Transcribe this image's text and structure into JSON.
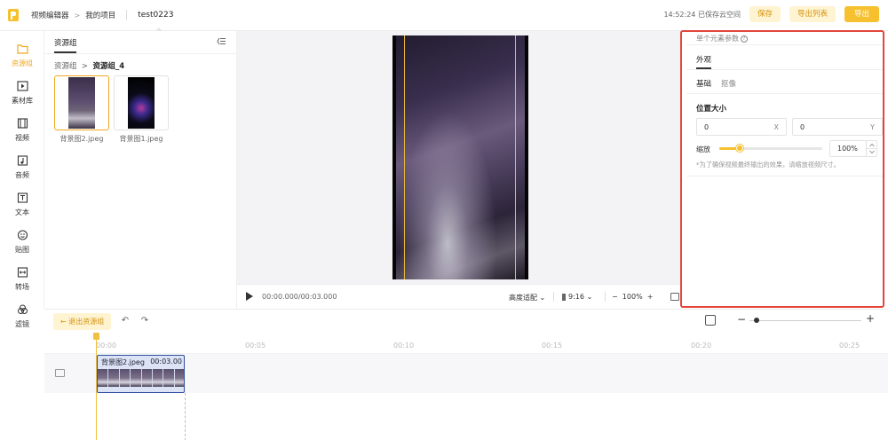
{
  "topbar": {
    "crumb_app": "视频编辑器",
    "crumb_project": "我的项目",
    "project_title": "test0223",
    "tooltip": "test0223",
    "save_status": "14:52:24 已保存云空间",
    "save_label": "保存",
    "export_list_label": "导出列表",
    "export_label": "导出"
  },
  "nav": {
    "items": [
      {
        "label": "资源组",
        "icon": "folder-icon"
      },
      {
        "label": "素材库",
        "icon": "media-library-icon"
      },
      {
        "label": "视频",
        "icon": "film-icon"
      },
      {
        "label": "音频",
        "icon": "music-icon"
      },
      {
        "label": "文本",
        "icon": "text-icon"
      },
      {
        "label": "贴图",
        "icon": "sticker-icon"
      },
      {
        "label": "转场",
        "icon": "transition-icon"
      },
      {
        "label": "滤镜",
        "icon": "filter-icon"
      }
    ]
  },
  "resources": {
    "title": "资源组",
    "breadcrumb_root": "资源组",
    "breadcrumb_current": "资源组_4",
    "assets": [
      {
        "name": "背景图2.jpeg",
        "selected": true
      },
      {
        "name": "背景图1.jpeg",
        "selected": false
      }
    ]
  },
  "player": {
    "timecode": "00:00.000/00:03.000",
    "fit_mode": "高度适配",
    "ratio": "9:16",
    "zoom": "100%"
  },
  "props": {
    "header": "单个元素参数",
    "tab_main": "外观",
    "sub_basic": "基础",
    "sub_matting": "抠像",
    "section_position": "位置大小",
    "x_value": "0",
    "x_unit": "X",
    "y_value": "0",
    "y_unit": "Y",
    "scale_label": "缩放",
    "scale_value": "100%",
    "scale_fraction": 0.2,
    "note": "*为了确保视频最终输出的效果，请缩放视频尺寸。"
  },
  "timeline": {
    "exit_label": "退出资源组",
    "ruler": [
      "00:00",
      "00:05",
      "00:10",
      "00:15",
      "00:20",
      "00:25"
    ],
    "clip_name": "背景图2.jpeg",
    "clip_duration": "00:03.00"
  },
  "colors": {
    "accent": "#f6c02e",
    "highlight_box": "#e2463c",
    "clip_border": "#3050a0"
  }
}
